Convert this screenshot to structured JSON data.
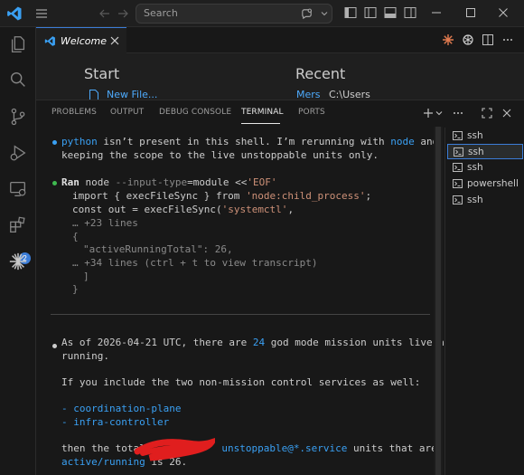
{
  "titlebar": {
    "search_placeholder": "Search"
  },
  "editor_tab": {
    "label": "Welcome"
  },
  "welcome": {
    "start_heading": "Start",
    "recent_heading": "Recent",
    "new_file_label": "New File...",
    "recent_items": [
      {
        "name": "Mers",
        "path": "C:\\Users"
      }
    ]
  },
  "activity_bar": {
    "extensions_badge": "2"
  },
  "panel": {
    "tabs": [
      "PROBLEMS",
      "OUTPUT",
      "DEBUG CONSOLE",
      "TERMINAL",
      "PORTS"
    ],
    "active_tab": "TERMINAL"
  },
  "terminal": {
    "msg1_cmd": "python",
    "msg1_a": " isn’t present in this shell. I’m rerunning with ",
    "msg1_cmd2": "node",
    "msg1_b": " and",
    "msg1_line2": "keeping the scope to the live unstoppable units only.",
    "ran_label": "Ran",
    "ran_cmd": " node ",
    "ran_flag": "--input-type",
    "ran_rest": "=module <<",
    "ran_eof": "'EOF'",
    "code1a": "import { execFileSync } from ",
    "code1b": "'node:child_process'",
    "code1c": ";",
    "code2a": "const out = execFileSync(",
    "code2b": "'systemctl'",
    "code2c": ",",
    "more1": "… +23 lines",
    "brace_open": "{",
    "json_line": "\"activeRunningTotal\": 26,",
    "more2": "… +34 lines (ctrl + t to view transcript)",
    "bracket_close": "]",
    "brace_close": "}",
    "p1a": "As of 2026-04-21 UTC, there are ",
    "p1_num": "24",
    "p1b": " god mode mission units live and",
    "p1_line2": "running.",
    "p2": "If you include the two non-mission control services as well:",
    "list": [
      "- coordination-plane",
      "- infra-controller"
    ],
    "p3a": "then the total ",
    "p3_unit": "unstoppable@*.service",
    "p3b": " units that are",
    "p3_line2a": "active/running",
    "p3_line2b": " is 26."
  },
  "terminal_list": {
    "items": [
      "ssh",
      "ssh",
      "ssh",
      "powershell",
      "ssh"
    ],
    "active_index": 1
  }
}
